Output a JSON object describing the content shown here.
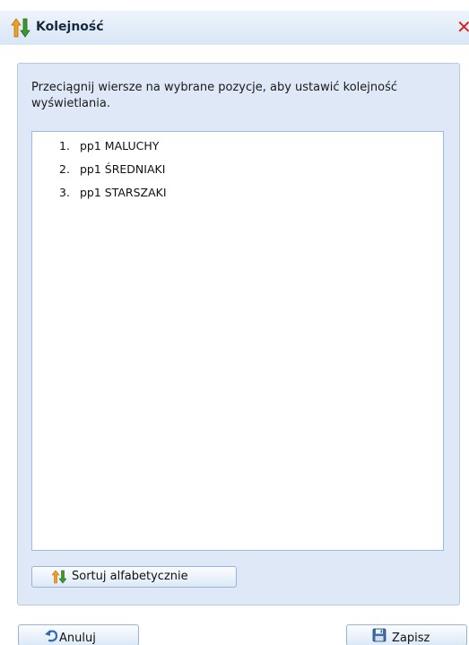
{
  "dialog": {
    "title": "Kolejność",
    "close_symbol": "✕",
    "title_icon": "reorder-arrows-icon"
  },
  "panel": {
    "instructions": "Przeciągnij wiersze na wybrane pozycje, aby ustawić kolejność wyświetlania.",
    "items": [
      {
        "number": "1.",
        "label": "pp1 MALUCHY"
      },
      {
        "number": "2.",
        "label": "pp1 ŚREDNIAKI"
      },
      {
        "number": "3.",
        "label": "pp1 STARSZAKI"
      }
    ],
    "sort_button": {
      "label": "Sortuj alfabetycznie",
      "icon": "sort-icon"
    }
  },
  "footer": {
    "cancel_button": {
      "label": "Anuluj",
      "icon": "undo-icon"
    },
    "save_button": {
      "label": "Zapisz",
      "icon": "floppy-disk-icon"
    }
  },
  "colors": {
    "panel_background": "#dfe8f6",
    "panel_border": "#b7c9e3",
    "list_border": "#99bbe8",
    "close_red": "#d8211c",
    "arrow_orange": "#f0a020",
    "arrow_green": "#3c9a2c"
  }
}
